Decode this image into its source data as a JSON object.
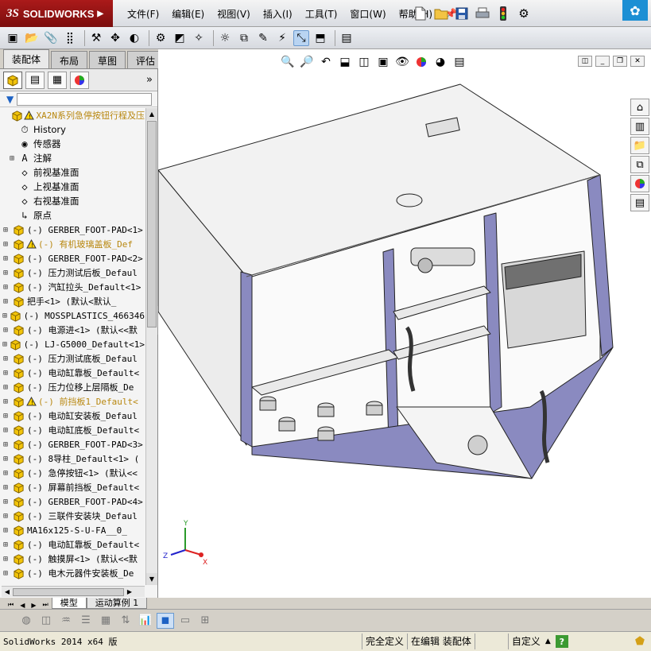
{
  "app": {
    "name": "SOLIDWORKS",
    "logo_mark": "3S"
  },
  "menu": {
    "items": [
      "文件(F)",
      "编辑(E)",
      "视图(V)",
      "插入(I)",
      "工具(T)",
      "窗口(W)",
      "帮助(H)"
    ]
  },
  "command_tabs": [
    "装配体",
    "布局",
    "草图",
    "评估"
  ],
  "feature_tree": {
    "root_label": "XA2N系列急停按钮行程及压",
    "fixed_items": [
      {
        "label": "History",
        "icon": "history-icon"
      },
      {
        "label": "传感器",
        "icon": "sensor-icon"
      },
      {
        "label": "注解",
        "icon": "annotation-icon"
      },
      {
        "label": "前视基准面",
        "icon": "plane-icon"
      },
      {
        "label": "上视基准面",
        "icon": "plane-icon"
      },
      {
        "label": "右视基准面",
        "icon": "plane-icon"
      },
      {
        "label": "原点",
        "icon": "origin-icon"
      }
    ],
    "components": [
      {
        "label": "(-) GERBER_FOOT-PAD<1>",
        "warning": false
      },
      {
        "label": "(-) 有机玻璃盖板_Def",
        "warning": true
      },
      {
        "label": "(-) GERBER_FOOT-PAD<2>",
        "warning": false
      },
      {
        "label": "(-) 压力测试后板_Defaul",
        "warning": false
      },
      {
        "label": "(-) 汽缸拉头_Default<1>",
        "warning": false
      },
      {
        "label": "把手<1> (默认<默认_",
        "warning": false
      },
      {
        "label": "(-) MOSSPLASTICS_466346",
        "warning": false
      },
      {
        "label": "(-) 电源进<1> (默认<<默",
        "warning": false
      },
      {
        "label": "(-) LJ-G5000_Default<1>",
        "warning": false
      },
      {
        "label": "(-) 压力测试底板_Defaul",
        "warning": false
      },
      {
        "label": "(-) 电动缸靠板_Default<",
        "warning": false
      },
      {
        "label": "(-) 压力位移上层隔板_De",
        "warning": false
      },
      {
        "label": "(-) 前挡板1_Default<",
        "warning": true
      },
      {
        "label": "(-) 电动缸安装板_Defaul",
        "warning": false
      },
      {
        "label": "(-) 电动缸底板_Default<",
        "warning": false
      },
      {
        "label": "(-) GERBER_FOOT-PAD<3>",
        "warning": false
      },
      {
        "label": "(-) 8导柱_Default<1> (",
        "warning": false
      },
      {
        "label": "(-) 急停按钮<1> (默认<<",
        "warning": false
      },
      {
        "label": "(-) 屏幕前挡板_Default<",
        "warning": false
      },
      {
        "label": "(-) GERBER_FOOT-PAD<4>",
        "warning": false
      },
      {
        "label": "(-) 三联件安装块_Defaul",
        "warning": false
      },
      {
        "label": "MA16x125-S-U-FA__0_",
        "warning": false
      },
      {
        "label": "(-) 电动缸靠板_Default<",
        "warning": false
      },
      {
        "label": "(-) 触摸屏<1> (默认<<默",
        "warning": false
      },
      {
        "label": "(-) 电木元器件安装板_De",
        "warning": false
      }
    ]
  },
  "bottom_tabs": [
    "模型",
    "运动算例 1"
  ],
  "status": {
    "app_version": "SolidWorks 2014 x64 版",
    "definition": "完全定义",
    "mode": "在编辑 装配体",
    "units": "自定义",
    "help": "?"
  },
  "triad": {
    "x": "X",
    "y": "Y",
    "z": "Z"
  },
  "colors": {
    "logo_bg": "#9b1414",
    "accent": "#1c8fd4",
    "warning": "#ffd200",
    "component_yellow": "#f2c40a",
    "model_plate": "#8a8ac0",
    "viewport_bg": "#ffffff"
  }
}
